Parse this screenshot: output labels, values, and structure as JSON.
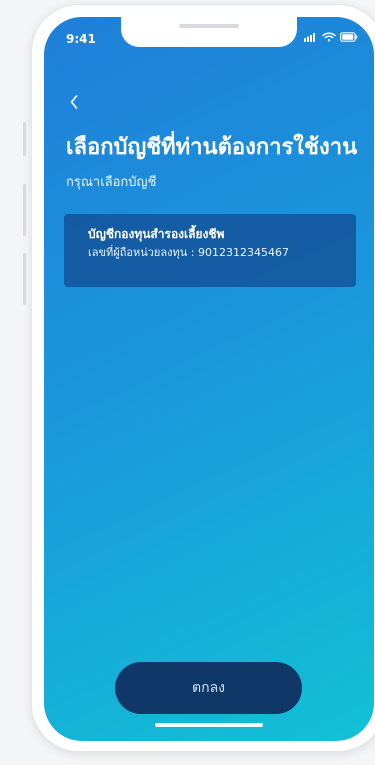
{
  "status_bar": {
    "time": "9:41",
    "icons": [
      "signal-icon",
      "wifi-icon",
      "battery-icon"
    ]
  },
  "header": {
    "title": "เลือกบัญชีที่ท่านต้องการใช้งาน",
    "subtitle": "กรุณาเลือกบัญชี"
  },
  "account": {
    "title": "บัญชีกองทุนสำรองเลี้ยงชีพ",
    "holder_label": "เลขที่ผู้ถือหน่วยลงทุน",
    "holder_number": "9012312345467",
    "holder_line": "เลขที่ผู้ถือหน่วยลงทุน : 9012312345467"
  },
  "actions": {
    "confirm_label": "ตกลง"
  },
  "theme": {
    "gradient_start": "#1f7fd9",
    "gradient_end": "#12c1d5",
    "card_bg": "#124c92",
    "button_bg": "#0f3767",
    "button_text": "#cfe3f8"
  }
}
